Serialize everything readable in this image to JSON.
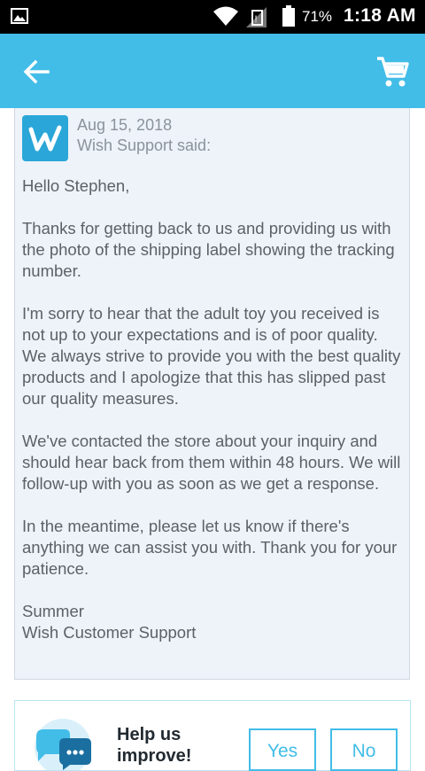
{
  "status_bar": {
    "battery_percent": "71%",
    "time": "1:18 AM",
    "icons": [
      "gallery-icon",
      "wifi-icon",
      "no-sim-icon",
      "battery-icon"
    ]
  },
  "app_bar": {
    "color": "#42bde8",
    "icons": [
      "back-arrow-icon",
      "shopping-cart-icon"
    ]
  },
  "message": {
    "date": "Aug 15, 2018",
    "sender": "Wish Support said:",
    "avatar_logo": "w",
    "greeting": "Hello Stephen,",
    "paragraphs": [
      "Thanks for getting back to us and providing us with the photo of the shipping label showing the tracking number.",
      "I'm sorry to hear that the adult toy you received is not up to your expectations and is of poor quality. We always strive to provide you with the best quality products and I apologize that this has slipped past our quality measures.",
      "We've contacted the store about your inquiry and should hear back from them within 48 hours. We will follow-up with you as soon as we get a response.",
      "In the meantime, please let us know if there's anything we can assist you with. Thank you for your patience."
    ],
    "signature_name": "Summer",
    "signature_team": "Wish Customer Support"
  },
  "feedback": {
    "title": "Help us improve!",
    "yes_label": "Yes",
    "no_label": "No",
    "icon": "chat-bubbles-icon"
  }
}
